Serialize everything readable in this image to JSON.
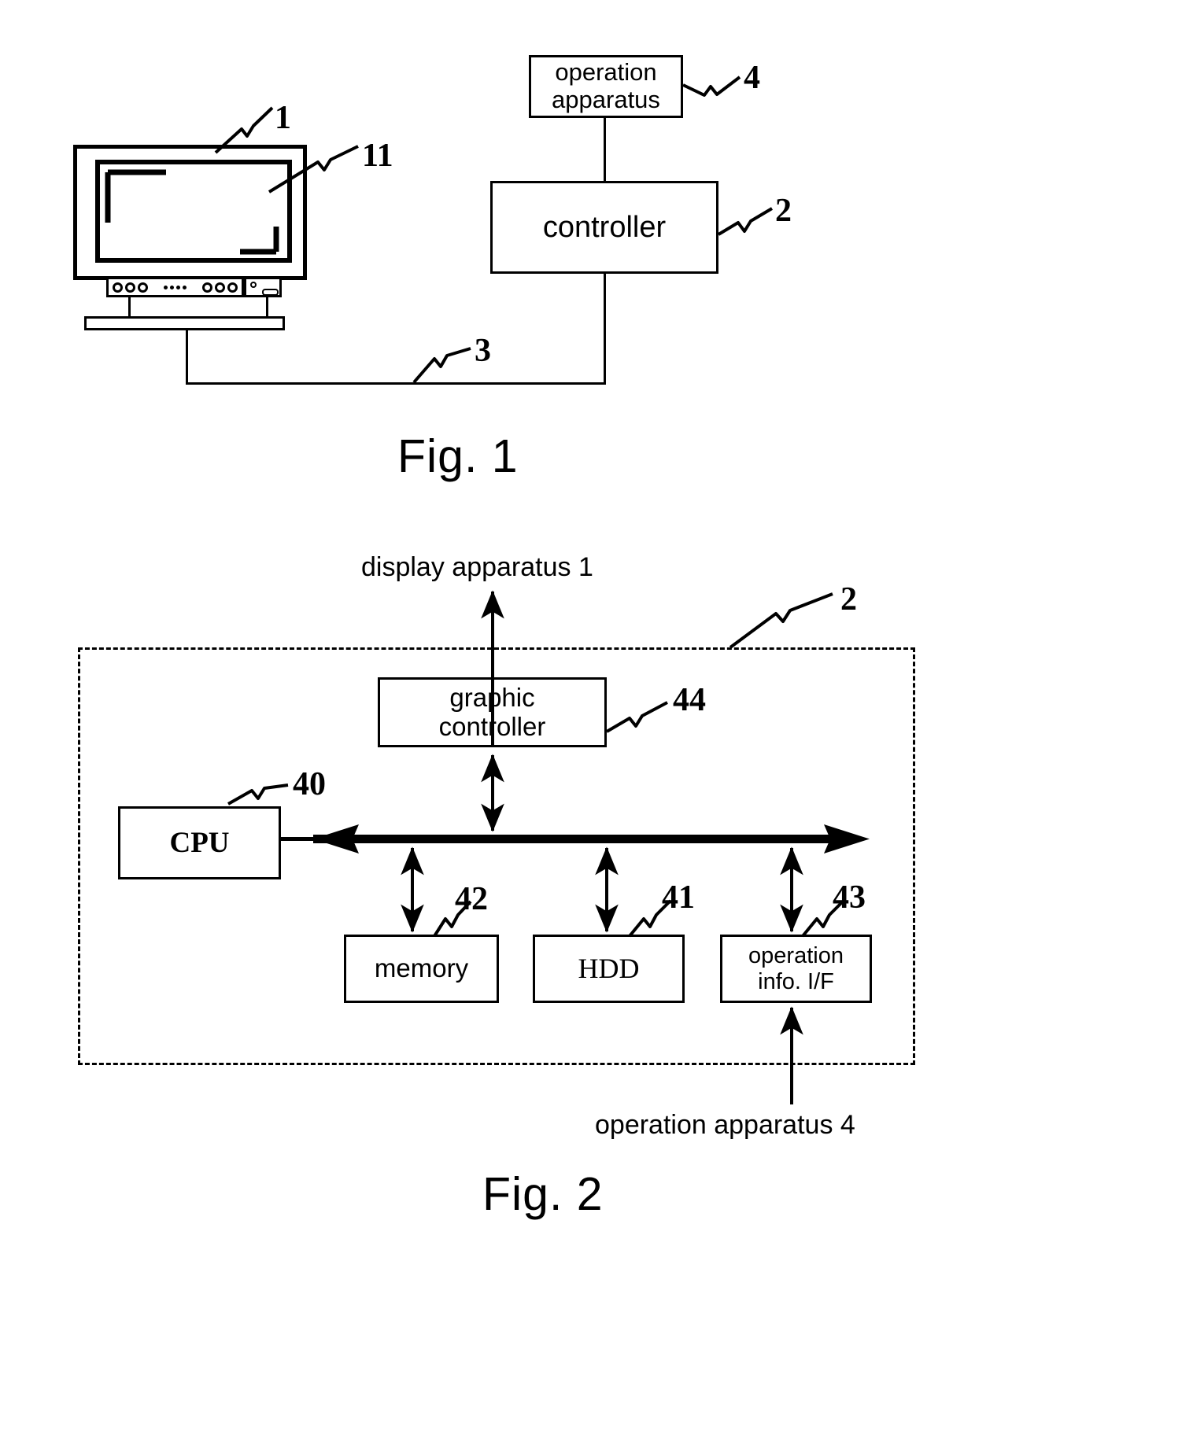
{
  "figures": [
    {
      "caption": "Fig. 1",
      "elements": {
        "display_ref": "1",
        "screen_ref": "11",
        "operation_apparatus_label": "operation\napparatus",
        "operation_apparatus_line1": "operation",
        "operation_apparatus_line2": "apparatus",
        "operation_apparatus_ref": "4",
        "controller_label": "controller",
        "controller_ref": "2",
        "cable_ref": "3"
      }
    },
    {
      "caption": "Fig. 2",
      "elements": {
        "top_arrow_label": "display apparatus 1",
        "bottom_arrow_label": "operation apparatus 4",
        "container_ref": "2",
        "graphic_controller_line1": "graphic",
        "graphic_controller_line2": "controller",
        "graphic_controller_ref": "44",
        "cpu_label": "CPU",
        "cpu_ref": "40",
        "memory_label": "memory",
        "memory_ref": "42",
        "hdd_label": "HDD",
        "hdd_ref": "41",
        "operation_if_line1": "operation",
        "operation_if_line2": "info. I/F",
        "operation_if_ref": "43"
      }
    }
  ],
  "fig1": {
    "caption": "Fig. 1",
    "display_ref": "1",
    "screen_ref": "11",
    "op_line1": "operation",
    "op_line2": "apparatus",
    "op_ref": "4",
    "controller_label": "controller",
    "controller_ref": "2",
    "cable_ref": "3"
  },
  "fig2": {
    "caption": "Fig. 2",
    "top_label": "display apparatus 1",
    "bottom_label": "operation apparatus 4",
    "container_ref": "2",
    "gc_line1": "graphic",
    "gc_line2": "controller",
    "gc_ref": "44",
    "cpu_label": "CPU",
    "cpu_ref": "40",
    "memory_label": "memory",
    "memory_ref": "42",
    "hdd_label": "HDD",
    "hdd_ref": "41",
    "opif_line1": "operation",
    "opif_line2": "info. I/F",
    "opif_ref": "43"
  },
  "colors": {
    "ink": "#000000",
    "paper": "#ffffff"
  }
}
